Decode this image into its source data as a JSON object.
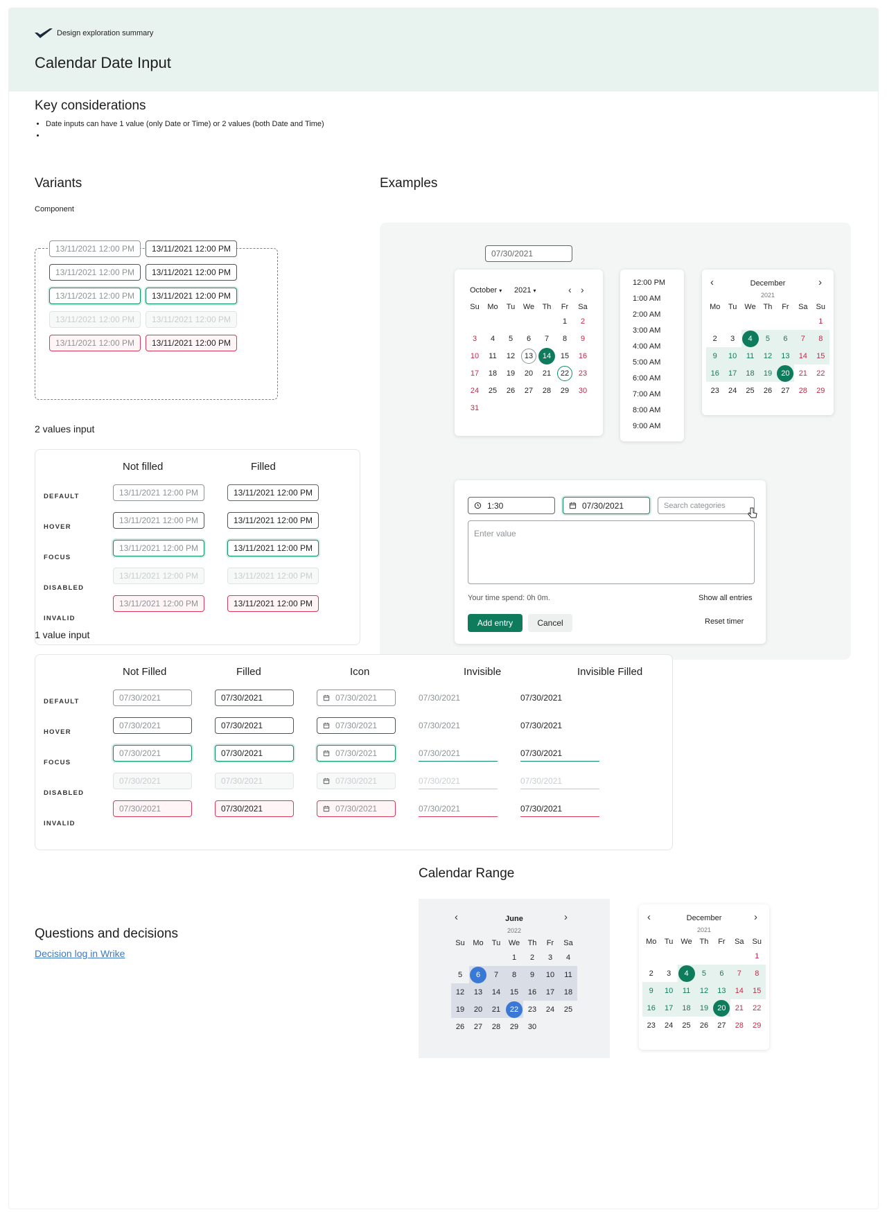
{
  "header": {
    "brand": "Design exploration summary",
    "title": "Calendar Date Input"
  },
  "considerations": {
    "heading": "Key considerations",
    "bullets": [
      "Date inputs can have 1 value (only Date or Time) or 2 values (both Date and Time)",
      ""
    ]
  },
  "variants": {
    "heading": "Variants",
    "component_label": "Component",
    "date": "13/11/2021",
    "time": "12:00 PM"
  },
  "two_values": {
    "heading": "2 values input",
    "columns": [
      "Not filled",
      "Filled"
    ],
    "rows": [
      "DEFAULT",
      "HOVER",
      "FOCUS",
      "DISABLED",
      "INVALID"
    ],
    "date": "13/11/2021",
    "time": "12:00 PM"
  },
  "one_value": {
    "heading": "1 value input",
    "columns": [
      "Not Filled",
      "Filled",
      "Icon",
      "Invisible",
      "Invisible Filled"
    ],
    "rows": [
      "DEFAULT",
      "HOVER",
      "FOCUS",
      "DISABLED",
      "INVALID"
    ],
    "date": "07/30/2021"
  },
  "examples": {
    "heading": "Examples",
    "date_input": "07/30/2021",
    "cal1": {
      "month": "October",
      "year": "2021",
      "days": [
        "Su",
        "Mo",
        "Tu",
        "We",
        "Th",
        "Fr",
        "Sa"
      ]
    },
    "times": [
      "12:00 PM",
      "1:00 AM",
      "2:00 AM",
      "3:00 AM",
      "4:00 AM",
      "5:00 AM",
      "6:00 AM",
      "7:00 AM",
      "8:00 AM",
      "9:00 AM"
    ],
    "cal2": {
      "month": "December",
      "year": "2021",
      "days": [
        "Mo",
        "Tu",
        "We",
        "Th",
        "Fr",
        "Sa",
        "Su"
      ]
    },
    "form": {
      "time_value": "1:30",
      "date_value": "07/30/2021",
      "search_placeholder": "Search categories",
      "textarea_placeholder": "Enter value",
      "time_spent": "Your time spend: 0h 0m.",
      "show_all": "Show all entries",
      "add": "Add entry",
      "cancel": "Cancel",
      "reset": "Reset timer"
    }
  },
  "range": {
    "heading": "Calendar Range",
    "cal_a": {
      "month": "June",
      "year": "2022",
      "days": [
        "Su",
        "Mo",
        "Tu",
        "We",
        "Th",
        "Fr",
        "Sa"
      ]
    },
    "cal_b": {
      "month": "December",
      "year": "2021",
      "days": [
        "Mo",
        "Tu",
        "We",
        "Th",
        "Fr",
        "Sa",
        "Su"
      ]
    }
  },
  "questions": {
    "heading": "Questions and decisions",
    "link": "Decision log in Wrike"
  },
  "colors": {
    "accent": "#0e7b5c",
    "invalid": "#d6395a",
    "range_blue": "#3a78d6",
    "header_bg": "#e8f2ef"
  }
}
